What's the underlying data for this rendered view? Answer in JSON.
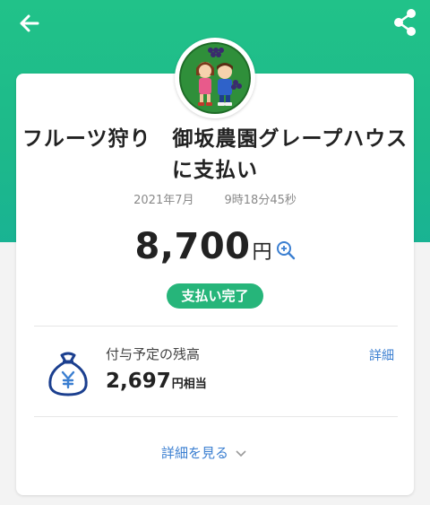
{
  "header": {
    "back_icon": "arrow-left-icon",
    "share_icon": "share-icon"
  },
  "merchant": {
    "name": "フルーツ狩り　御坂農園グレープハウスに支払い",
    "avatar_icon": "merchant-logo-kids-with-grapes"
  },
  "transaction": {
    "date": "2021年7月",
    "time": "9時18分45秒",
    "amount": "8,700",
    "currency": "円",
    "status": "支払い完了"
  },
  "balance": {
    "label": "付与予定の残高",
    "value": "2,697",
    "unit": "円相当",
    "detail_link": "詳細",
    "icon": "yen-moneybag-icon"
  },
  "footer": {
    "see_details": "詳細を見る"
  },
  "colors": {
    "header_green": "#21c289",
    "status_green": "#26b57a",
    "link_blue": "#3b7fd1",
    "icon_navy": "#1b3f8f"
  }
}
